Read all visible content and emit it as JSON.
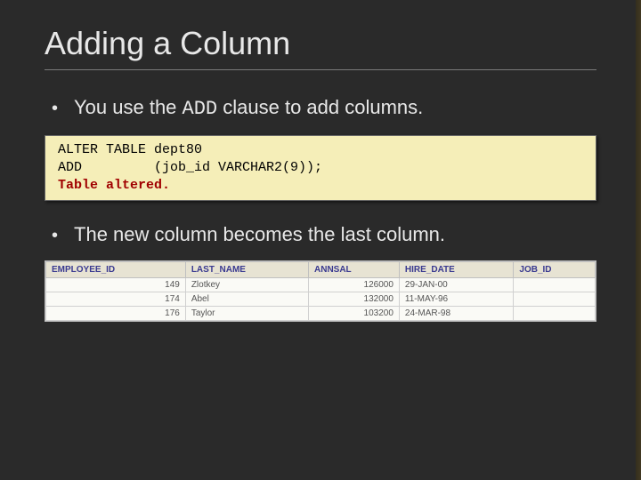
{
  "title": "Adding a Column",
  "bullets": {
    "one": "You use the ",
    "one_mono": "ADD",
    "one_tail": " clause to add columns.",
    "two": "The new column becomes the last column."
  },
  "code": {
    "line1": "ALTER TABLE dept80",
    "line2": "ADD         (job_id VARCHAR2(9));",
    "line3": "Table altered."
  },
  "table": {
    "headers": [
      "EMPLOYEE_ID",
      "LAST_NAME",
      "ANNSAL",
      "HIRE_DATE",
      "JOB_ID"
    ],
    "rows": [
      {
        "emp": "149",
        "last": "Zlotkey",
        "ann": "126000",
        "hire": "29-JAN-00",
        "job": ""
      },
      {
        "emp": "174",
        "last": "Abel",
        "ann": "132000",
        "hire": "11-MAY-96",
        "job": ""
      },
      {
        "emp": "176",
        "last": "Taylor",
        "ann": "103200",
        "hire": "24-MAR-98",
        "job": ""
      }
    ]
  }
}
